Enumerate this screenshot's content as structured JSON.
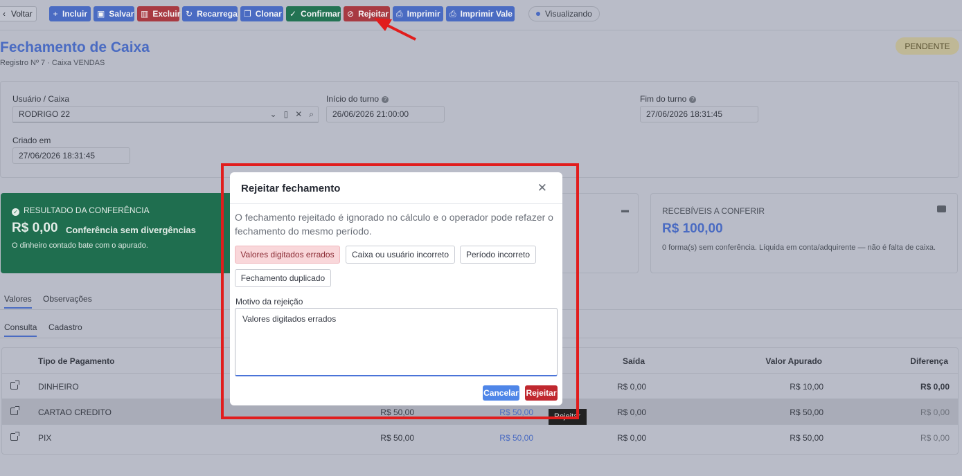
{
  "toolbar": {
    "back": "Voltar",
    "buttons": [
      {
        "label": "Incluir",
        "icon": "plus-icon"
      },
      {
        "label": "Salvar",
        "icon": "save-icon"
      },
      {
        "label": "Excluir",
        "icon": "trash-icon"
      },
      {
        "label": "Recarrega",
        "icon": "refresh-icon"
      },
      {
        "label": "Clonar",
        "icon": "copy-icon"
      },
      {
        "label": "Confirmar",
        "icon": "check-icon"
      },
      {
        "label": "Rejeitar",
        "icon": "ban-icon"
      },
      {
        "label": "Imprimir",
        "icon": "print-icon"
      },
      {
        "label": "Imprimir Vale",
        "icon": "print-icon"
      }
    ],
    "mode": "Visualizando"
  },
  "header": {
    "title": "Fechamento de Caixa",
    "subtitle": "Registro Nº 7 · Caixa VENDAS",
    "status": "PENDENTE"
  },
  "form": {
    "user_label": "Usuário / Caixa",
    "user_value": "RODRIGO 22",
    "start_label": "Início do turno",
    "start_value": "26/06/2026 21:00:00",
    "end_label": "Fim do turno",
    "end_value": "27/06/2026 18:31:45",
    "created_label": "Criado em",
    "created_value": "27/06/2026 18:31:45"
  },
  "result": {
    "title": "RESULTADO DA CONFERÊNCIA",
    "value": "R$ 0,00",
    "label": "Conferência sem divergências",
    "desc": "O dinheiro contado bate com o apurado."
  },
  "receivables": {
    "title": "RECEBÍVEIS A CONFERIR",
    "value": "R$ 100,00",
    "desc": "0 forma(s) sem conferência. Líquida em conta/adquirente — não é falta de caixa."
  },
  "tabs": {
    "main": [
      "Valores",
      "Observações"
    ],
    "sub": [
      "Consulta",
      "Cadastro"
    ]
  },
  "table": {
    "headers": {
      "type": "Tipo de Pagamento",
      "out": "Saída",
      "calc": "Valor Apurado",
      "diff": "Diferença"
    },
    "rows": [
      {
        "type": "DINHEIRO",
        "c1": "",
        "c2": "",
        "out": "R$ 0,00",
        "calc": "R$ 10,00",
        "diff": "R$ 0,00"
      },
      {
        "type": "CARTAO CREDITO",
        "c1": "R$ 50,00",
        "c2": "R$ 50,00",
        "out": "R$ 0,00",
        "calc": "R$ 50,00",
        "diff": "R$ 0,00"
      },
      {
        "type": "PIX",
        "c1": "R$ 50,00",
        "c2": "R$ 50,00",
        "out": "R$ 0,00",
        "calc": "R$ 50,00",
        "diff": "R$ 0,00"
      }
    ]
  },
  "tooltip": "Rejeitar",
  "modal": {
    "title": "Rejeitar fechamento",
    "desc": "O fechamento rejeitado é ignorado no cálculo e o operador pode refazer o fechamento do mesmo período.",
    "reasons": [
      "Valores digitados errados",
      "Caixa ou usuário incorreto",
      "Período incorreto",
      "Fechamento duplicado"
    ],
    "reason_label": "Motivo da rejeição",
    "reason_value": "Valores digitados errados",
    "cancel": "Cancelar",
    "confirm": "Rejeitar"
  },
  "colors": {
    "accent": "#4a6bc2",
    "danger": "#c0282f",
    "success": "#1f6e4f",
    "highlight": "#e11d1d"
  }
}
